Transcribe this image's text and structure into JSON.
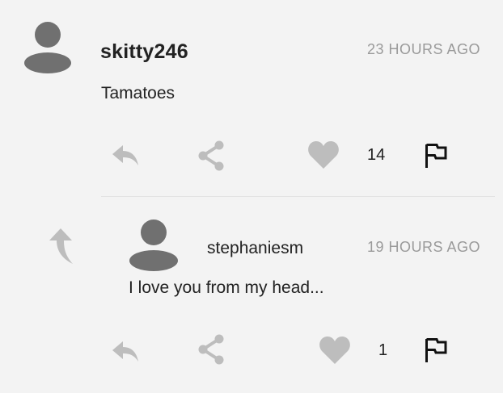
{
  "comments": [
    {
      "username": "skitty246",
      "time": "23 HOURS AGO",
      "text": "Tamatoes",
      "like_count": "14"
    },
    {
      "username": "stephaniesm",
      "time": "19 HOURS AGO",
      "text": "I love you from my head...",
      "like_count": "1"
    }
  ],
  "icons": {
    "avatar": "user-avatar-icon",
    "reply": "reply-arrow-icon",
    "share": "share-icon",
    "like": "heart-icon",
    "flag": "flag-icon",
    "thread": "up-arrow-icon"
  },
  "colors": {
    "background": "#f3f3f3",
    "avatar": "#707070",
    "action_icon": "#bdbdbd",
    "text": "#222222",
    "timestamp": "#9a9a9a"
  }
}
